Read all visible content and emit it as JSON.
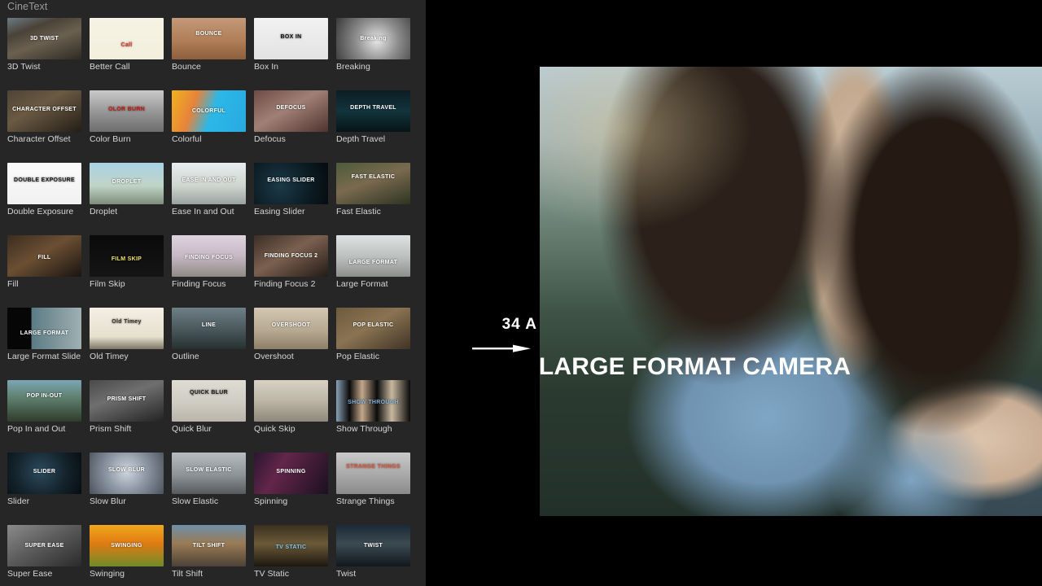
{
  "app": {
    "background_color": "#000000",
    "panel_color": "#262626"
  },
  "browser": {
    "title": "CineText",
    "columns": 5,
    "items": [
      {
        "label": "3D Twist",
        "thumb_text": "3D TWIST",
        "thumb_style": "building"
      },
      {
        "label": "Better Call",
        "thumb_text": "Call",
        "thumb_style": "liberty"
      },
      {
        "label": "Bounce",
        "thumb_text": "BOUNCE",
        "thumb_style": "tennis"
      },
      {
        "label": "Box In",
        "thumb_text": "BOX IN",
        "thumb_style": "boxin"
      },
      {
        "label": "Breaking",
        "thumb_text": "Breaking",
        "thumb_style": "smoke"
      },
      {
        "label": "Character Offset",
        "thumb_text": "CHARACTER OFFSET",
        "thumb_style": "soldier"
      },
      {
        "label": "Color Burn",
        "thumb_text": "OLOR BURN",
        "thumb_style": "colorburn"
      },
      {
        "label": "Colorful",
        "thumb_text": "COLORFUL",
        "thumb_style": "colorful"
      },
      {
        "label": "Defocus",
        "thumb_text": "DEFOCUS",
        "thumb_style": "defocus"
      },
      {
        "label": "Depth Travel",
        "thumb_text": "DEPTH TRAVEL",
        "thumb_style": "depth"
      },
      {
        "label": "Double Exposure",
        "thumb_text": "DOUBLE EXPOSURE",
        "thumb_style": "doubleexp"
      },
      {
        "label": "Droplet",
        "thumb_text": "DROPLET",
        "thumb_style": "droplet"
      },
      {
        "label": "Ease In and Out",
        "thumb_text": "EASE IN AND OUT",
        "thumb_style": "skate"
      },
      {
        "label": "Easing Slider",
        "thumb_text": "EASING SLIDER",
        "thumb_style": "easing"
      },
      {
        "label": "Fast Elastic",
        "thumb_text": "FAST ELASTIC",
        "thumb_style": "fastelastic"
      },
      {
        "label": "Fill",
        "thumb_text": "FILL",
        "thumb_style": "fill"
      },
      {
        "label": "Film Skip",
        "thumb_text": "FILM SKIP",
        "thumb_style": "filmskip"
      },
      {
        "label": "Finding Focus",
        "thumb_text": "FINDING FOCUS",
        "thumb_style": "findingfocus"
      },
      {
        "label": "Finding Focus 2",
        "thumb_text": "FINDING FOCUS 2",
        "thumb_style": "findingfocus2"
      },
      {
        "label": "Large Format",
        "thumb_text": "LARGE FORMAT",
        "thumb_style": "largeformat"
      },
      {
        "label": "Large Format Slide",
        "thumb_text": "LARGE FORMAT",
        "thumb_style": "lfslide"
      },
      {
        "label": "Old Timey",
        "thumb_text": "Old Timey",
        "thumb_style": "oldtimey"
      },
      {
        "label": "Outline",
        "thumb_text": "LINE",
        "thumb_style": "outline"
      },
      {
        "label": "Overshoot",
        "thumb_text": "OVERSHOOT",
        "thumb_style": "overshoot"
      },
      {
        "label": "Pop Elastic",
        "thumb_text": "POP ELASTIC",
        "thumb_style": "popelastic"
      },
      {
        "label": "Pop In and Out",
        "thumb_text": "POP IN-OUT",
        "thumb_style": "popinout"
      },
      {
        "label": "Prism Shift",
        "thumb_text": "PRISM SHIFT",
        "thumb_style": "prism"
      },
      {
        "label": "Quick Blur",
        "thumb_text": "QUICK BLUR",
        "thumb_style": "quickblur"
      },
      {
        "label": "Quick Skip",
        "thumb_text": "",
        "thumb_style": "quickskip"
      },
      {
        "label": "Show Through",
        "thumb_text": "SHOW THROUGH",
        "thumb_style": "showthrough"
      },
      {
        "label": "Slider",
        "thumb_text": "SLIDER",
        "thumb_style": "slider"
      },
      {
        "label": "Slow Blur",
        "thumb_text": "SLOW BLUR",
        "thumb_style": "slowblur"
      },
      {
        "label": "Slow Elastic",
        "thumb_text": "SLOW ELASTIC",
        "thumb_style": "slowelastic"
      },
      {
        "label": "Spinning",
        "thumb_text": "SPINNING",
        "thumb_style": "spinning"
      },
      {
        "label": "Strange Things",
        "thumb_text": "STRANGE THINGS",
        "thumb_style": "strange"
      },
      {
        "label": "Super Ease",
        "thumb_text": "SUPER EASE",
        "thumb_style": "superease"
      },
      {
        "label": "Swinging",
        "thumb_text": "SWINGING",
        "thumb_style": "swinging"
      },
      {
        "label": "Tilt Shift",
        "thumb_text": "TILT SHIFT",
        "thumb_style": "tiltshift"
      },
      {
        "label": "TV Static",
        "thumb_text": "TV STATIC",
        "thumb_style": "tvstatic"
      },
      {
        "label": "Twist",
        "thumb_text": "TWIST",
        "thumb_style": "twist"
      }
    ]
  },
  "viewer": {
    "overlay": {
      "scene_number": "34 A",
      "title": "LARGE FORMAT CAMERA",
      "arrow_icon": "arrow-right-icon",
      "text_color": "#ffffff"
    }
  }
}
